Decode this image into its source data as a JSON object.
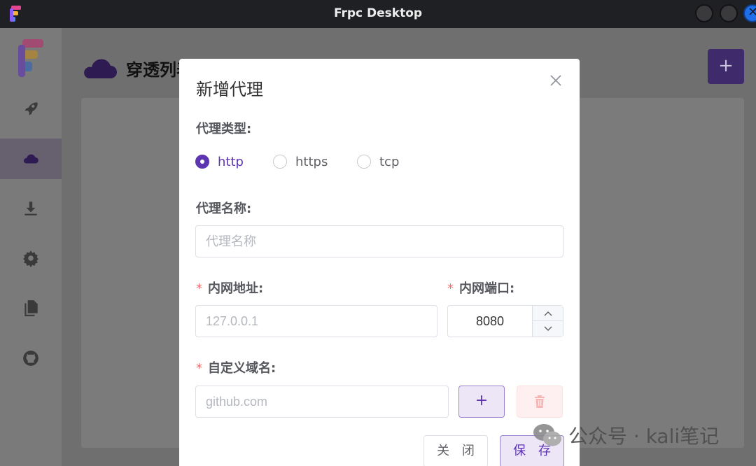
{
  "window": {
    "title": "Frpc Desktop",
    "icons": [
      "app-logo-icon",
      "minimize-icon",
      "maximize-icon",
      "close-icon"
    ]
  },
  "sidebar": {
    "items": [
      {
        "icon": "rocket-icon",
        "active": false
      },
      {
        "icon": "cloud-icon",
        "active": true
      },
      {
        "icon": "download-icon",
        "active": false
      },
      {
        "icon": "gear-icon",
        "active": false
      },
      {
        "icon": "document-icon",
        "active": false
      },
      {
        "icon": "github-icon",
        "active": false
      }
    ]
  },
  "main": {
    "title": "穿透列表",
    "add_label": "+"
  },
  "dialog": {
    "title": "新增代理",
    "type_label": "代理类型:",
    "types": [
      "http",
      "https",
      "tcp"
    ],
    "selected_type": "http",
    "name_label": "代理名称:",
    "name_placeholder": "代理名称",
    "addr_label": "内网地址:",
    "addr_placeholder": "127.0.0.1",
    "port_label": "内网端口:",
    "port_value": "8080",
    "domain_label": "自定义域名:",
    "domain_placeholder": "github.com",
    "add_domain_label": "+",
    "cancel_label": "关 闭",
    "save_label": "保 存",
    "required_mark": "*"
  },
  "watermark": {
    "text": "公众号 · kali笔记"
  },
  "colors": {
    "accent": "#5e35b1",
    "required": "#f56c6c",
    "titlebar": "#1f2023"
  }
}
